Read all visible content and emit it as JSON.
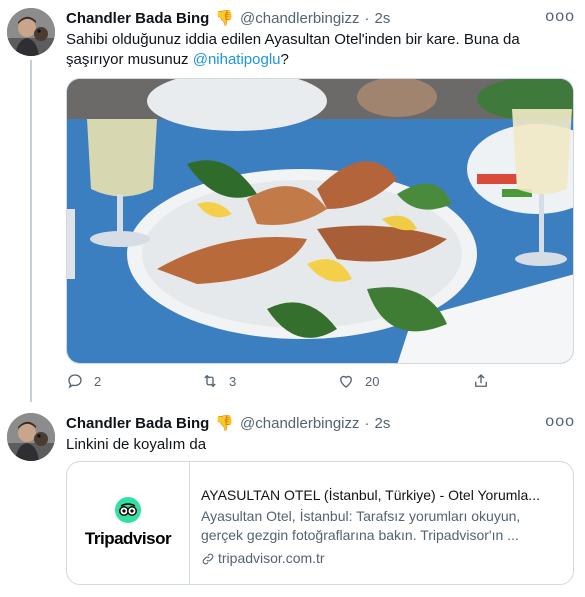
{
  "tweets": [
    {
      "author": {
        "name": "Chandler Bada Bing",
        "emoji": "👎",
        "handle": "@chandlerbingizz",
        "separator": "·",
        "time": "2s"
      },
      "text_before": "Sahibi olduğunuz iddia edilen Ayasultan Otel'inden bir kare. Buna da şaşırıyor musunuz ",
      "mention": "@nihatipoglu",
      "text_after": "?",
      "media": {
        "alt": "Photo of grilled prawns on a plate with lemon and greens, glasses of wine on a blue tablecloth"
      },
      "actions": {
        "replies": "2",
        "retweets": "3",
        "likes": "20"
      }
    },
    {
      "author": {
        "name": "Chandler Bada Bing",
        "emoji": "👎",
        "handle": "@chandlerbingizz",
        "separator": "·",
        "time": "2s"
      },
      "text": "Linkini de koyalım da",
      "card": {
        "logo_text": "Tripadvisor",
        "title": "AYASULTAN OTEL (İstanbul, Türkiye) - Otel Yorumla...",
        "description": "Ayasultan Otel, İstanbul: Tarafsız yorumları okuyun, gerçek gezgin fotoğraflarına bakın. Tripadvisor'ın ...",
        "url": "tripadvisor.com.tr"
      }
    }
  ],
  "more_label": "ooo",
  "colors": {
    "mention": "#1b95e0",
    "secondary": "#536471",
    "tripadvisor_green": "#34e0a1",
    "tablecloth": "#3b7fc0"
  },
  "icons": [
    "reply-icon",
    "retweet-icon",
    "like-icon",
    "share-icon",
    "link-icon",
    "tripadvisor-owl-icon"
  ]
}
